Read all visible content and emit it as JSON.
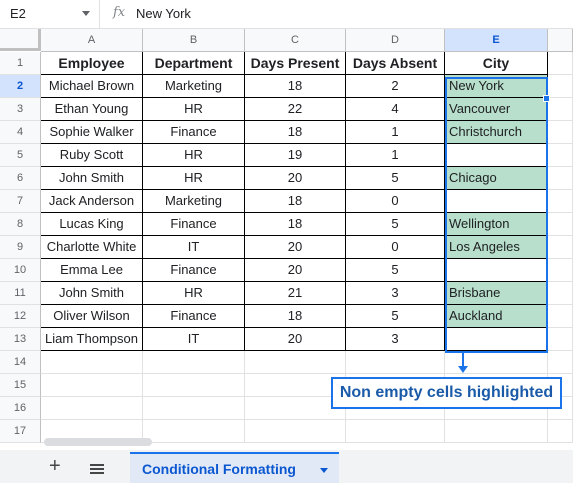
{
  "formula_bar": {
    "name_box": "E2",
    "fx_icon": "fx-icon",
    "value": "New York"
  },
  "columns": [
    "A",
    "B",
    "C",
    "D",
    "E"
  ],
  "active_column": "E",
  "row_numbers": [
    "1",
    "2",
    "3",
    "4",
    "5",
    "6",
    "7",
    "8",
    "9",
    "10",
    "11",
    "12",
    "13",
    "14",
    "15",
    "16",
    "17"
  ],
  "active_row": "2",
  "table": {
    "headers": [
      "Employee",
      "Department",
      "Days Present",
      "Days Absent",
      "City"
    ],
    "rows": [
      [
        "Michael Brown",
        "Marketing",
        "18",
        "2",
        "New York"
      ],
      [
        "Ethan Young",
        "HR",
        "22",
        "4",
        "Vancouver"
      ],
      [
        "Sophie Walker",
        "Finance",
        "18",
        "1",
        "Christchurch"
      ],
      [
        "Ruby Scott",
        "HR",
        "19",
        "1",
        ""
      ],
      [
        "John Smith",
        "HR",
        "20",
        "5",
        "Chicago"
      ],
      [
        "Jack Anderson",
        "Marketing",
        "18",
        "0",
        ""
      ],
      [
        "Lucas King",
        "Finance",
        "18",
        "5",
        "Wellington"
      ],
      [
        "Charlotte White",
        "IT",
        "20",
        "0",
        "Los Angeles"
      ],
      [
        "Emma Lee",
        "Finance",
        "20",
        "5",
        ""
      ],
      [
        "John Smith",
        "HR",
        "21",
        "3",
        "Brisbane"
      ],
      [
        "Oliver Wilson",
        "Finance",
        "18",
        "5",
        "Auckland"
      ],
      [
        "Liam Thompson",
        "IT",
        "20",
        "3",
        ""
      ]
    ]
  },
  "highlight_color": "#b7dfcc",
  "selection_color": "#1a73e8",
  "annotation": {
    "text": "Non empty cells highlighted",
    "arrow_icon": "arrow-down-icon"
  },
  "sheet_bar": {
    "add_icon": "plus-icon",
    "all_sheets_icon": "menu-icon",
    "active_tab": "Conditional Formatting",
    "tab_caret_icon": "caret-down-icon"
  }
}
